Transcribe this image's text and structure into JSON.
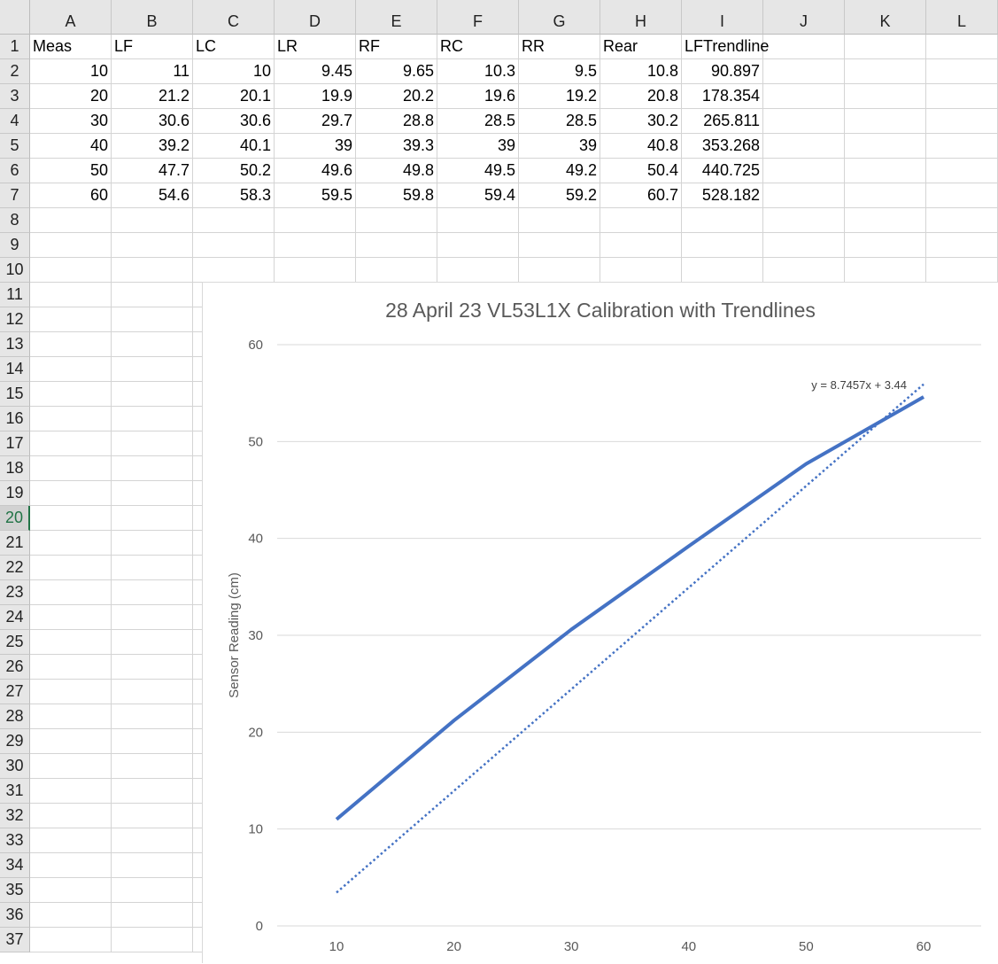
{
  "sheet": {
    "columns": [
      "A",
      "B",
      "C",
      "D",
      "E",
      "F",
      "G",
      "H",
      "I",
      "J",
      "K",
      "L"
    ],
    "row_numbers": [
      "1",
      "2",
      "3",
      "4",
      "5",
      "6",
      "7",
      "8",
      "9",
      "10",
      "11",
      "12",
      "13",
      "14",
      "15",
      "16",
      "17",
      "18",
      "19",
      "20",
      "21",
      "22",
      "23",
      "24",
      "25",
      "26",
      "27",
      "28",
      "29",
      "30",
      "31",
      "32",
      "33",
      "34",
      "35",
      "36",
      "37"
    ],
    "active_row": "20",
    "headers": [
      "Meas",
      "LF",
      "LC",
      "LR",
      "RF",
      "RC",
      "RR",
      "Rear",
      "LFTrendline"
    ],
    "rows": [
      [
        "10",
        "11",
        "10",
        "9.45",
        "9.65",
        "10.3",
        "9.5",
        "10.8",
        "90.897"
      ],
      [
        "20",
        "21.2",
        "20.1",
        "19.9",
        "20.2",
        "19.6",
        "19.2",
        "20.8",
        "178.354"
      ],
      [
        "30",
        "30.6",
        "30.6",
        "29.7",
        "28.8",
        "28.5",
        "28.5",
        "30.2",
        "265.811"
      ],
      [
        "40",
        "39.2",
        "40.1",
        "39",
        "39.3",
        "39",
        "39",
        "40.8",
        "353.268"
      ],
      [
        "50",
        "47.7",
        "50.2",
        "49.6",
        "49.8",
        "49.5",
        "49.2",
        "50.4",
        "440.725"
      ],
      [
        "60",
        "54.6",
        "58.3",
        "59.5",
        "59.8",
        "59.4",
        "59.2",
        "60.7",
        "528.182"
      ]
    ]
  },
  "chart_data": {
    "type": "line",
    "title": "28 April 23 VL53L1X Calibration with Trendlines",
    "xlabel": "",
    "ylabel": "Sensor Reading (cm)",
    "x": [
      10,
      20,
      30,
      40,
      50,
      60
    ],
    "x_tick_labels": [
      "10",
      "20",
      "30",
      "40",
      "50",
      "60"
    ],
    "ylim": [
      0,
      60
    ],
    "y_ticks": [
      0,
      10,
      20,
      30,
      40,
      50,
      60
    ],
    "y_tick_labels": [
      "0",
      "10",
      "20",
      "30",
      "40",
      "50",
      "60"
    ],
    "grid": true,
    "series": [
      {
        "values": [
          11,
          21.2,
          30.6,
          39.2,
          47.7,
          54.6
        ],
        "color": "#4472c4",
        "style": "solid"
      }
    ],
    "trendline": {
      "slope": 8.7457,
      "intercept": 3.44,
      "x_from": 10,
      "x_to": 60,
      "label": "y = 8.7457x + 3.44",
      "color": "#4472c4",
      "style": "dotted"
    }
  }
}
